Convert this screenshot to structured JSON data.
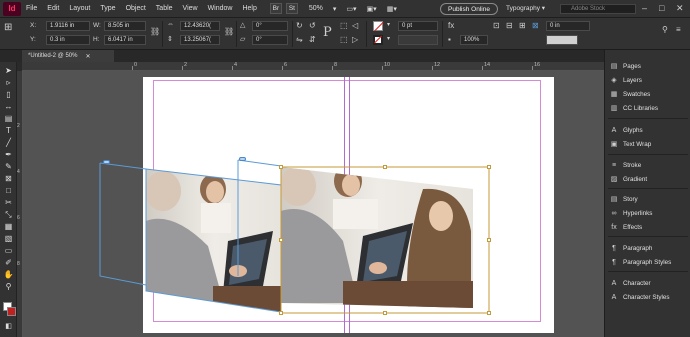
{
  "menubar": {
    "app_logo": "Id",
    "menus": [
      "File",
      "Edit",
      "Layout",
      "Type",
      "Object",
      "Table",
      "View",
      "Window",
      "Help"
    ],
    "br_label": "Br",
    "st_label": "St",
    "zoom": "50%",
    "publish_label": "Publish Online",
    "workspace": "Typography",
    "stock_search_placeholder": "Adobe Stock"
  },
  "controlbar": {
    "x_label": "X:",
    "x_value": "1.9116 in",
    "y_label": "Y:",
    "y_value": "0.3 in",
    "w_label": "W:",
    "w_value": "8.505 in",
    "h_label": "H:",
    "h_value": "6.0417 in",
    "scale_x": "12.43620(",
    "scale_y": "13.25067(",
    "rotation": "0°",
    "shear": "0°",
    "stroke_weight": "0 pt",
    "opacity": "100%",
    "offset": "0 in"
  },
  "document": {
    "tab_title": "*Untitled-2 @ 50%"
  },
  "ruler": {
    "top_ticks": [
      "0",
      "2",
      "4",
      "6",
      "8",
      "10",
      "12",
      "14",
      "16"
    ],
    "left_ticks": [
      "2",
      "4",
      "6",
      "8"
    ]
  },
  "panel": {
    "items": [
      {
        "icon": "pages-icon",
        "label": "Pages"
      },
      {
        "icon": "layers-icon",
        "label": "Layers"
      },
      {
        "icon": "swatches-icon",
        "label": "Swatches"
      },
      {
        "icon": "cc-libraries-icon",
        "label": "CC Libraries"
      },
      {
        "icon": "glyphs-icon",
        "label": "Glyphs"
      },
      {
        "icon": "text-wrap-icon",
        "label": "Text Wrap"
      },
      {
        "icon": "stroke-icon",
        "label": "Stroke"
      },
      {
        "icon": "gradient-icon",
        "label": "Gradient"
      },
      {
        "icon": "story-icon",
        "label": "Story"
      },
      {
        "icon": "hyperlinks-icon",
        "label": "Hyperlinks"
      },
      {
        "icon": "effects-icon",
        "label": "Effects"
      },
      {
        "icon": "paragraph-icon",
        "label": "Paragraph"
      },
      {
        "icon": "paragraph-styles-icon",
        "label": "Paragraph Styles"
      },
      {
        "icon": "character-icon",
        "label": "Character"
      },
      {
        "icon": "character-styles-icon",
        "label": "Character Styles"
      }
    ]
  },
  "colors": {
    "accent_frame": "#c49a3a",
    "guide_magenta": "#d58ad5",
    "selection_blue": "#5b9bd5"
  }
}
